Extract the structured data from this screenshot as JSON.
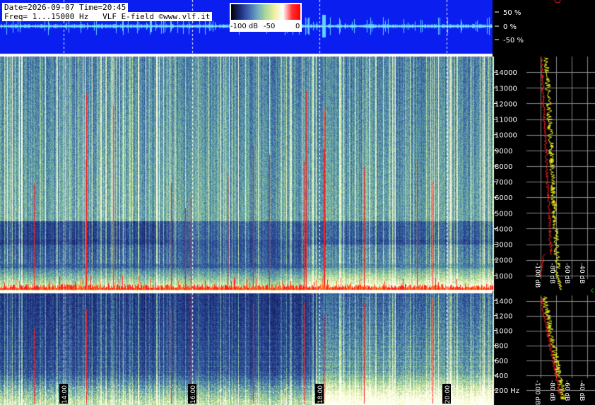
{
  "header": {
    "date_time": "Date=2026-09-07 Time=20:45",
    "freq_info": "Freq= 1...15000 Hz",
    "station": "VLF E-field ©www.vlf.it"
  },
  "legend": {
    "labels": [
      "-100 dB",
      "-50",
      "0"
    ],
    "colors": [
      "#000000",
      "#1b2a78",
      "#3d63b0",
      "#6fa8c0",
      "#a9d99a",
      "#f0f0a0",
      "#ffffff",
      "#ff3030",
      "#ff0000"
    ]
  },
  "waveform": {
    "scale_labels": [
      "50 %",
      "0 %",
      "-50 %"
    ],
    "background_color": "#0a1ef0",
    "trace_color": "#5fd0ff"
  },
  "upper_panel": {
    "freq_ticks": [
      "14000",
      "13000",
      "12000",
      "11000",
      "10000",
      "9000",
      "8000",
      "7000",
      "6000",
      "5000",
      "4000",
      "3000",
      "2000",
      "1000"
    ],
    "db_ticks": [
      "-100 dB",
      "-80 dB",
      "-60 dB",
      "-40 dB",
      "-20 dB"
    ]
  },
  "lower_panel": {
    "freq_ticks": [
      "1400",
      "1200",
      "1000",
      "800",
      "600",
      "400",
      "200 Hz"
    ],
    "db_ticks": [
      "-100 dB",
      "-80 dB",
      "-60 dB",
      "-40 dB",
      "-20 dB"
    ]
  },
  "time_markers": [
    "14:00",
    "16:00",
    "18:00",
    "20:00"
  ],
  "colors": {
    "noise_floor": "#ff2020",
    "spectrum_red": "#ff2020",
    "spectrum_yellow": "#f0f020",
    "spectrogram_dark": "#1a2a78",
    "spectrogram_light": "#a9d9a0"
  }
}
